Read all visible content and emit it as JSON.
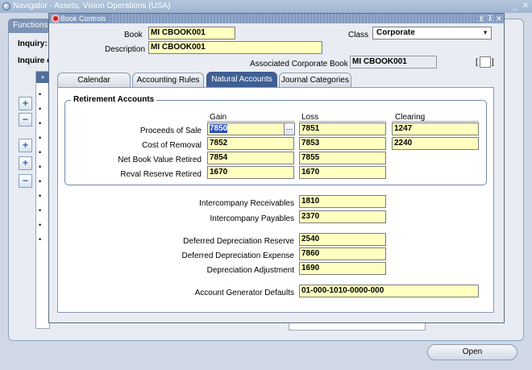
{
  "navigator": {
    "title": "Navigator - Assets, Vision Operations (USA)",
    "tab_label": "Functions",
    "inquiry_label": "Inquiry:",
    "inquire_label": "Inquire c",
    "open_button": "Open"
  },
  "dialog": {
    "title": "Book Controls",
    "book_label": "Book",
    "book_value": "MI CBOOK001",
    "class_label": "Class",
    "class_value": "Corporate",
    "description_label": "Description",
    "description_value": "MI CBOOK001",
    "assoc_label": "Associated Corporate Book",
    "assoc_value": "MI CBOOK001",
    "checkbox_open": "[",
    "checkbox_close": "]"
  },
  "tabs": [
    {
      "label": "Calendar"
    },
    {
      "label": "Accounting Rules"
    },
    {
      "label": "Natural Accounts"
    },
    {
      "label": "Journal Categories"
    }
  ],
  "retirement": {
    "group_title": "Retirement Accounts",
    "col_gain": "Gain",
    "col_loss": "Loss",
    "col_clearing": "Clearing",
    "rows": [
      {
        "label": "Proceeds of Sale",
        "gain": "7850",
        "loss": "7851",
        "clearing": "1247"
      },
      {
        "label": "Cost of Removal",
        "gain": "7852",
        "loss": "7853",
        "clearing": "2240"
      },
      {
        "label": "Net Book Value Retired",
        "gain": "7854",
        "loss": "7855"
      },
      {
        "label": "Reval Reserve Retired",
        "gain": "1670",
        "loss": "1670"
      }
    ]
  },
  "accounts": {
    "interco_rec_label": "Intercompany Receivables",
    "interco_rec_value": "1810",
    "interco_pay_label": "Intercompany Payables",
    "interco_pay_value": "2370",
    "def_dep_res_label": "Deferred Depreciation Reserve",
    "def_dep_res_value": "2540",
    "def_dep_exp_label": "Deferred Depreciation Expense",
    "def_dep_exp_value": "7860",
    "dep_adj_label": "Depreciation Adjustment",
    "dep_adj_value": "1690",
    "acct_gen_label": "Account Generator Defaults",
    "acct_gen_value": "01-000-1010-0000-000"
  },
  "icons": {
    "lov": "…",
    "select_arrow": "▼",
    "nav_minimize": "_",
    "nav_close": "✕",
    "dlg_min": "⊻",
    "dlg_max": "⊼",
    "dlg_close": "✕",
    "expand": "+",
    "collapse": "−",
    "expand_all": "+",
    "expand_branch": "+",
    "collapse_all": "−",
    "list_head": "+",
    "bullet": "•"
  }
}
